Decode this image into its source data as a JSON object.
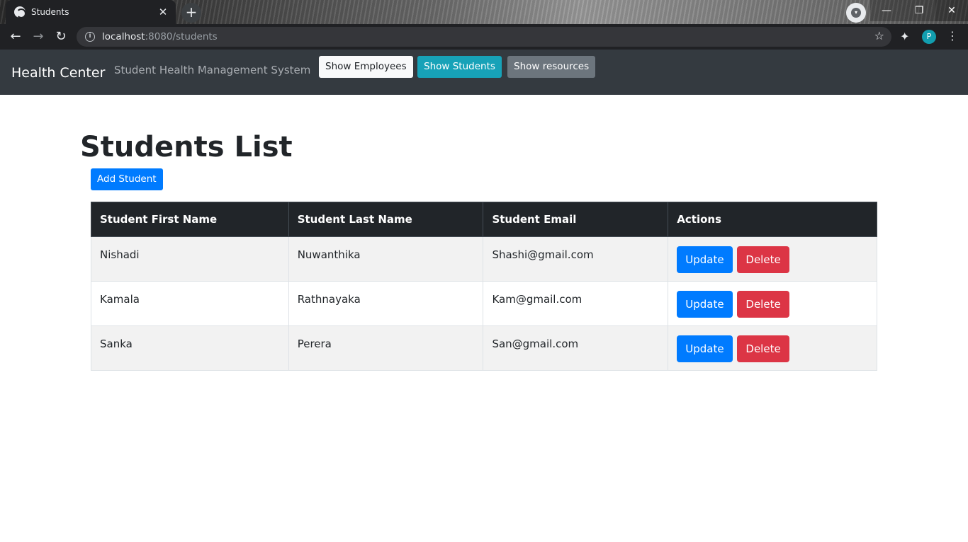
{
  "browser": {
    "tab_title": "Students",
    "tab_close": "✕",
    "new_tab": "+",
    "url_host": "localhost",
    "url_path": ":8080/students",
    "profile_initial": "P",
    "window_minimize": "—",
    "window_maximize": "❐",
    "window_close": "✕"
  },
  "navbar": {
    "brand": "Health Center",
    "subtitle": "Student Health Management System",
    "buttons": {
      "employees": "Show Employees",
      "students": "Show Students",
      "resources": "Show resources"
    }
  },
  "main": {
    "title": "Students List",
    "add_button": "Add Student",
    "table": {
      "headers": [
        "Student First Name",
        "Student Last Name",
        "Student Email",
        "Actions"
      ],
      "rows": [
        {
          "first": "Nishadi",
          "last": "Nuwanthika",
          "email": "Shashi@gmail.com",
          "update": "Update",
          "delete": "Delete"
        },
        {
          "first": "Kamala",
          "last": "Rathnayaka",
          "email": "Kam@gmail.com",
          "update": "Update",
          "delete": "Delete"
        },
        {
          "first": "Sanka",
          "last": "Perera",
          "email": "San@gmail.com",
          "update": "Update",
          "delete": "Delete"
        }
      ]
    }
  },
  "colors": {
    "navbar_bg": "#343a40",
    "primary": "#007bff",
    "info": "#17a2b8",
    "secondary": "#6c757d",
    "danger": "#dc3545",
    "table_header_bg": "#212529"
  }
}
